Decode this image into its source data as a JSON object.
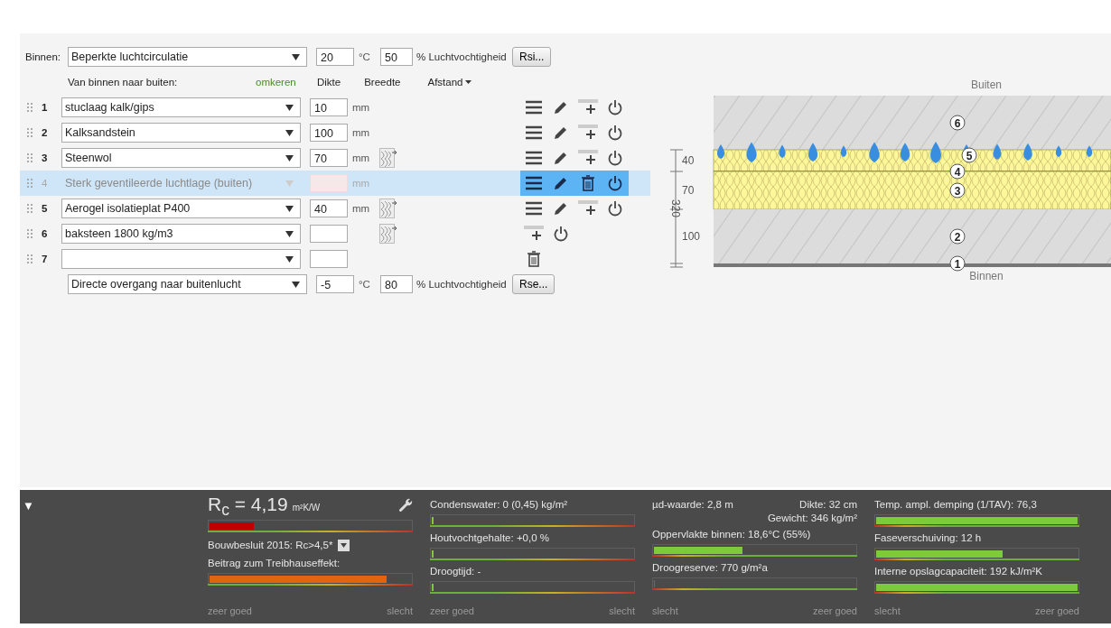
{
  "inside": {
    "label": "Binnen:",
    "climate": "Beperkte luchtcirculatie",
    "temperature": "20",
    "temp_unit": "°C",
    "humidity": "50",
    "humidity_label": "% Luchtvochtigheid",
    "button": "Rsi..."
  },
  "header": {
    "direction": "Van binnen naar buiten:",
    "reverse": "omkeren",
    "columns": [
      {
        "label": "Dikte",
        "kind": "plain"
      },
      {
        "label": "Breedte",
        "kind": "plain"
      },
      {
        "label": "Afstand",
        "kind": "menu"
      }
    ]
  },
  "layers": [
    {
      "number": "1",
      "material": "stuclaag kalk/gips",
      "thickness": "10",
      "unit": "mm",
      "texture": false,
      "disabled": false,
      "selected": false,
      "actions": [
        {
          "kind": "menu"
        },
        {
          "kind": "edit"
        },
        {
          "kind": "add"
        },
        {
          "kind": "power"
        }
      ]
    },
    {
      "number": "2",
      "material": "Kalksandstein",
      "thickness": "100",
      "unit": "mm",
      "texture": false,
      "disabled": false,
      "selected": false,
      "actions": [
        {
          "kind": "menu"
        },
        {
          "kind": "edit"
        },
        {
          "kind": "add"
        },
        {
          "kind": "power"
        }
      ]
    },
    {
      "number": "3",
      "material": "Steenwol",
      "thickness": "70",
      "unit": "mm",
      "texture": true,
      "disabled": false,
      "selected": false,
      "actions": [
        {
          "kind": "menu"
        },
        {
          "kind": "edit"
        },
        {
          "kind": "add"
        },
        {
          "kind": "power"
        }
      ]
    },
    {
      "number": "4",
      "material": "Sterk geventileerde luchtlage (buiten)",
      "unit": "mm",
      "texture": false,
      "disabled": true,
      "selected": true,
      "actions": [
        {
          "kind": "menu"
        },
        {
          "kind": "edit"
        },
        {
          "kind": "delete"
        },
        {
          "kind": "power"
        }
      ]
    },
    {
      "number": "5",
      "material": "Aerogel isolatieplat P400",
      "thickness": "40",
      "unit": "mm",
      "texture": true,
      "disabled": false,
      "selected": false,
      "actions": [
        {
          "kind": "menu"
        },
        {
          "kind": "edit"
        },
        {
          "kind": "add"
        },
        {
          "kind": "power"
        }
      ]
    },
    {
      "number": "6",
      "material": "baksteen 1800 kg/m3",
      "texture": true,
      "disabled": false,
      "selected": false,
      "actions": [
        {
          "kind": "add"
        },
        {
          "kind": "power"
        }
      ]
    },
    {
      "number": "7",
      "texture": false,
      "disabled": false,
      "selected": false,
      "actions": [
        {
          "kind": "delete"
        }
      ]
    }
  ],
  "outside": {
    "climate": "Directe overgang naar buitenlucht",
    "temperature": "-5",
    "temp_unit": "°C",
    "humidity": "80",
    "humidity_label": "% Luchtvochtigheid",
    "button": "Rse..."
  },
  "diagram": {
    "top_label": "Buiten",
    "bottom_label": "Binnen",
    "total": "320",
    "layers": [
      {
        "number": "6",
        "kind": "masonry",
        "moisture": false
      },
      {
        "number": "5",
        "kind": "insulation",
        "moisture": true,
        "dimension": "40"
      },
      {
        "number": "4",
        "kind": "membrane",
        "moisture": false
      },
      {
        "number": "3",
        "kind": "insulation",
        "moisture": false,
        "dimension": "70"
      },
      {
        "number": "2",
        "kind": "masonry",
        "moisture": false,
        "dimension": "100"
      },
      {
        "number": "1",
        "kind": "plaster",
        "moisture": false
      }
    ]
  },
  "results": {
    "toggle": "▼",
    "columns": [
      {
        "scale": {
          "kind": "falling",
          "start": "zeer goed",
          "end": "slecht"
        },
        "items": [
          {
            "kind": "headline",
            "text": "R$_{c}$ = 4,19",
            "unit": "m²K/W",
            "level": 0.22,
            "color": "#c00000"
          },
          {
            "kind": "dropdown",
            "text": "Bouwbesluit 2015: Rc>4,5*"
          },
          {
            "kind": "metric",
            "label": "Beitrag zum Treibhauseffekt:",
            "level": 0.88,
            "color": "#e0650f"
          }
        ]
      },
      {
        "scale": {
          "kind": "falling",
          "start": "zeer goed",
          "end": "slecht"
        },
        "items": [
          {
            "kind": "metric",
            "label": "Condenswater: 0 (0,45) kg/m²",
            "level": 0.01,
            "color": "#7ccb3a"
          },
          {
            "kind": "metric",
            "label": "Houtvochtgehalte: +0,0 %",
            "level": 0.01,
            "color": "#7ccb3a"
          },
          {
            "kind": "metric",
            "label": "Droogtijd: -",
            "level": 0.01,
            "color": "#7ccb3a"
          }
        ]
      },
      {
        "scale": {
          "kind": "rising",
          "start": "slecht",
          "end": "zeer goed"
        },
        "items": [
          {
            "kind": "info",
            "text": "µd-waarde: 2,8 m",
            "notes": [
              "Dikte: 32 cm",
              "Gewicht: 346 kg/m²"
            ]
          },
          {
            "kind": "metric",
            "label": "Oppervlakte binnen: 18,6°C (55%)",
            "level": 0.44,
            "color": "#7ccb3a"
          },
          {
            "kind": "metric",
            "label": "Droogreserve: 770 g/m²a",
            "level": 0
          }
        ]
      },
      {
        "scale": {
          "kind": "rising",
          "start": "slecht",
          "end": "zeer goed"
        },
        "items": [
          {
            "kind": "metric",
            "label": "Temp. ampl. demping (1/TAV): 76,3",
            "level": 1,
            "color": "#7ccb3a"
          },
          {
            "kind": "metric",
            "label": "Faseverschuiving: 12 h",
            "level": 0.63,
            "color": "#7ccb3a"
          },
          {
            "kind": "metric",
            "label": "Interne opslagcapaciteit: 192 kJ/m²K",
            "level": 1,
            "color": "#7ccb3a"
          }
        ]
      }
    ]
  }
}
